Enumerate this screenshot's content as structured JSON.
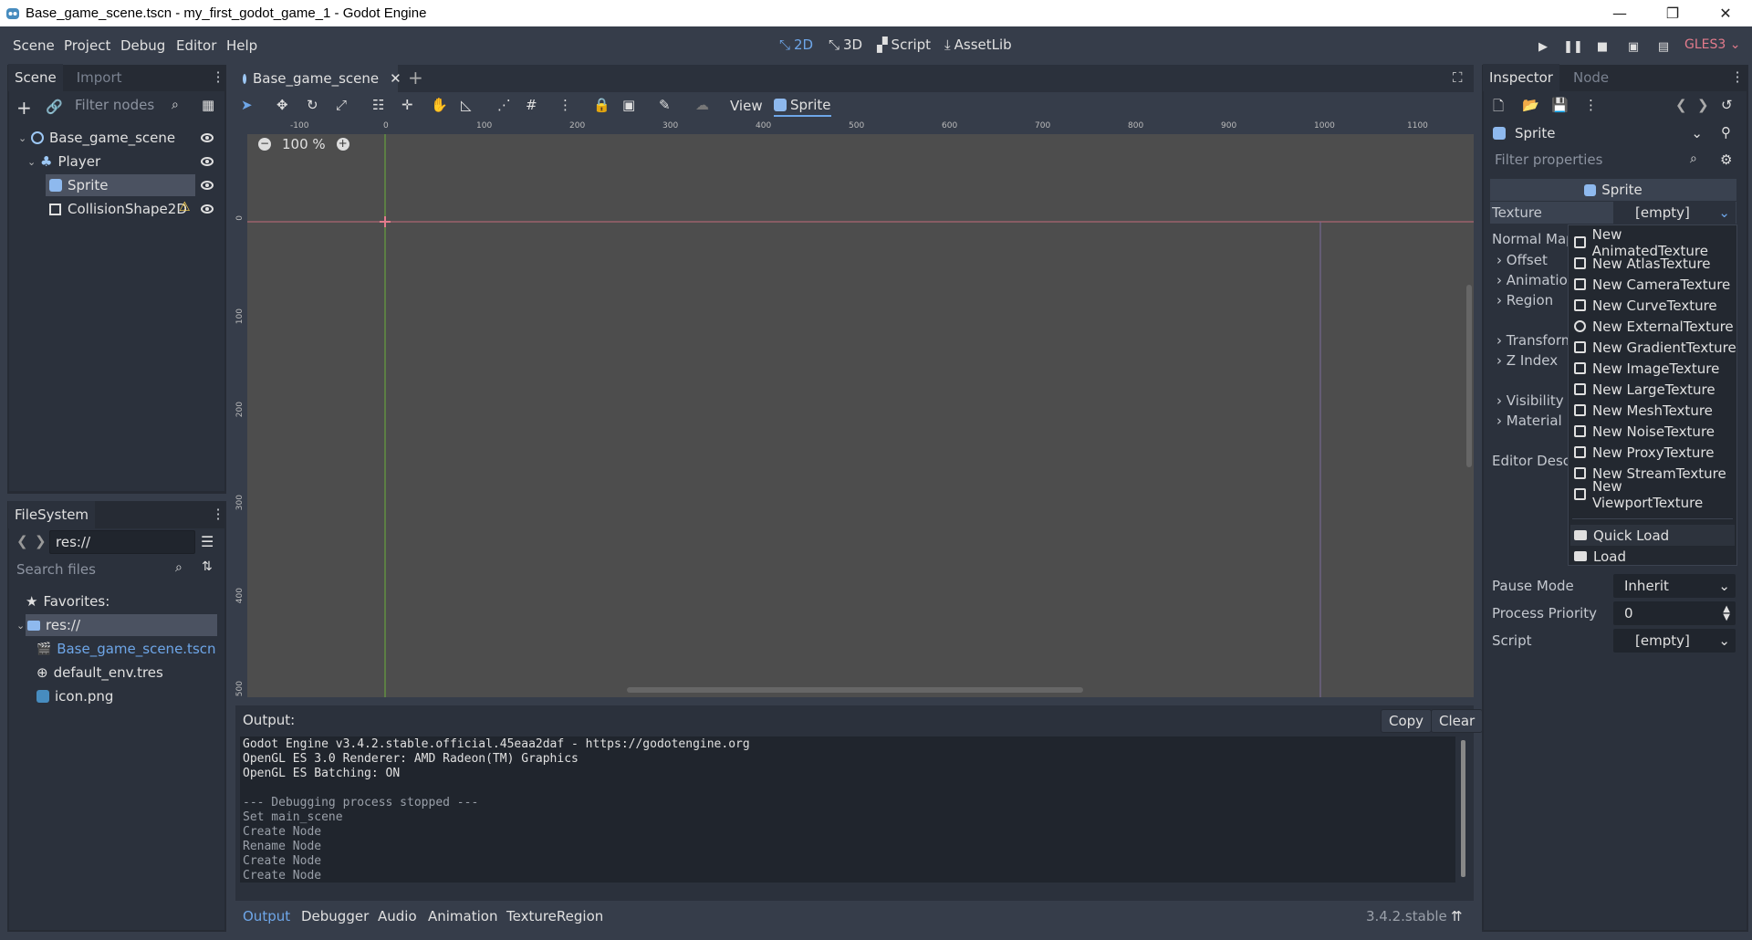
{
  "window": {
    "title": "Base_game_scene.tscn - my_first_godot_game_1 - Godot Engine",
    "controls": [
      "—",
      "❐",
      "✕"
    ]
  },
  "menu": [
    "Scene",
    "Project",
    "Debug",
    "Editor",
    "Help"
  ],
  "workspaces": [
    {
      "label": "2D",
      "icon": "2d-icon",
      "active": true
    },
    {
      "label": "3D",
      "icon": "3d-icon",
      "active": false
    },
    {
      "label": "Script",
      "icon": "script-icon",
      "active": false
    },
    {
      "label": "AssetLib",
      "icon": "assetlib-icon",
      "active": false
    }
  ],
  "renderer": "GLES3",
  "scene_dock": {
    "tabs": [
      "Scene",
      "Import"
    ],
    "filter_placeholder": "Filter nodes",
    "nodes": [
      {
        "label": "Base_game_scene",
        "icon": "node2d-icon",
        "depth": 0
      },
      {
        "label": "Player",
        "icon": "kinematicbody2d-icon",
        "depth": 1
      },
      {
        "label": "Sprite",
        "icon": "sprite-icon",
        "depth": 2,
        "selected": true
      },
      {
        "label": "CollisionShape2D",
        "icon": "collisionshape2d-icon",
        "depth": 2,
        "warning": true
      }
    ]
  },
  "filesystem": {
    "title": "FileSystem",
    "path": "res://",
    "search_placeholder": "Search files",
    "items": [
      {
        "label": "Favorites:",
        "icon": "star-icon"
      },
      {
        "label": "res://",
        "icon": "folder-icon",
        "selected": true
      },
      {
        "label": "Base_game_scene.tscn",
        "icon": "scene-file-icon",
        "highlight": true
      },
      {
        "label": "default_env.tres",
        "icon": "environment-icon"
      },
      {
        "label": "icon.png",
        "icon": "image-file-icon"
      }
    ]
  },
  "editor": {
    "tab": "Base_game_scene",
    "zoom": "100 %",
    "view_label": "View",
    "sprite_label": "Sprite",
    "ruler_h": [
      "-100",
      "0",
      "100",
      "200",
      "300",
      "400",
      "500",
      "600",
      "700",
      "800",
      "900",
      "1000",
      "1100"
    ],
    "ruler_v": [
      "0",
      "100",
      "200",
      "300",
      "400",
      "500"
    ]
  },
  "output": {
    "title": "Output:",
    "copy": "Copy",
    "clear": "Clear",
    "lines": [
      "Godot Engine v3.4.2.stable.official.45eaa2daf - https://godotengine.org",
      "OpenGL ES 3.0 Renderer: AMD Radeon(TM) Graphics",
      "OpenGL ES Batching: ON",
      "",
      "--- Debugging process stopped ---",
      "Set main_scene",
      "Create Node",
      "Rename Node",
      "Create Node",
      "Create Node"
    ],
    "bottom_tabs": [
      "Output",
      "Debugger",
      "Audio",
      "Animation",
      "TextureRegion"
    ],
    "version": "3.4.2.stable"
  },
  "inspector": {
    "tabs": [
      "Inspector",
      "Node"
    ],
    "object": "Sprite",
    "filter_placeholder": "Filter properties",
    "section": "Sprite",
    "texture_label": "Texture",
    "texture_value": "[empty]",
    "props": [
      "Normal Map",
      "Offset",
      "Animation",
      "Region",
      "Transform",
      "Z Index",
      "Visibility",
      "Material",
      "Editor Description"
    ],
    "pause_mode_label": "Pause Mode",
    "pause_mode_value": "Inherit",
    "process_priority_label": "Process Priority",
    "process_priority_value": "0",
    "script_label": "Script",
    "script_value": "[empty]"
  },
  "texture_menu": {
    "items": [
      "New AnimatedTexture",
      "New AtlasTexture",
      "New CameraTexture",
      "New CurveTexture",
      "New ExternalTexture",
      "New GradientTexture",
      "New ImageTexture",
      "New LargeTexture",
      "New MeshTexture",
      "New NoiseTexture",
      "New ProxyTexture",
      "New StreamTexture",
      "New ViewportTexture"
    ],
    "quick_load": "Quick Load",
    "load": "Load"
  },
  "colors": {
    "accent": "#6ea6e8",
    "bg": "#363d4a",
    "panel": "#2b313c",
    "viewport": "#4d4d4d",
    "renderer": "#e37b8c",
    "warning": "#ffd34e"
  }
}
